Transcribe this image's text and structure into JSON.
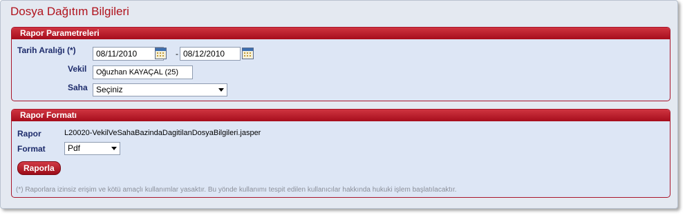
{
  "page": {
    "title": "Dosya Dağıtım Bilgileri"
  },
  "params": {
    "header": "Rapor Parametreleri",
    "date_label": "Tarih Aralığı (*)",
    "start_date": "08/11/2010",
    "separator": "-",
    "end_date": "08/12/2010",
    "vekil_label": "Vekil",
    "vekil_value": "Oğuzhan KAYAÇAL (25)",
    "saha_label": "Saha",
    "saha_value": "Seçiniz"
  },
  "format": {
    "header": "Rapor Formatı",
    "rapor_label": "Rapor",
    "rapor_value": "L20020-VekilVeSahaBazindaDagitilanDosyaBilgileri.jasper",
    "format_label": "Format",
    "format_value": "Pdf",
    "button_label": "Raporla",
    "disclaimer": "(*) Raporlara izinsiz erişim ve kötü amaçlı kullanımlar yasaktır. Bu yönde kullanımı tespit edilen kullanıcılar hakkında hukuki işlem başlatılacaktır."
  },
  "colors": {
    "accent": "#b0121c",
    "label": "#1d2b6b",
    "panel_bg": "#dde6f5"
  },
  "icons": {
    "calendar": "calendar-icon",
    "dropdown": "chevron-down-icon"
  }
}
